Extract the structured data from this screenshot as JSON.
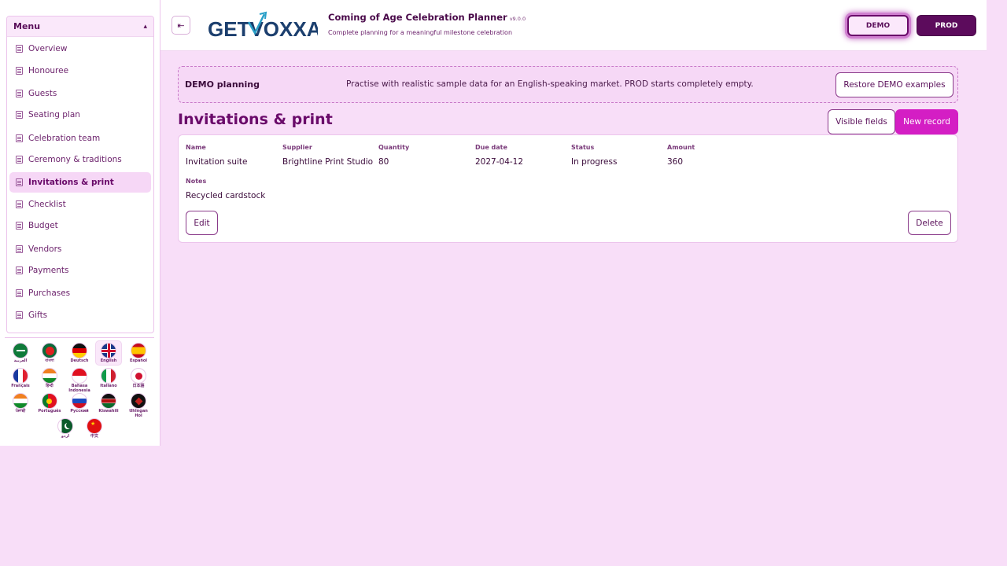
{
  "sidebar": {
    "menu_title": "Menu",
    "menu_toggle": "▴",
    "items": [
      {
        "label": "Overview"
      },
      {
        "label": "Honouree"
      },
      {
        "label": "Guests"
      },
      {
        "label": "Seating plan"
      },
      {
        "label": "Celebration team"
      },
      {
        "label": "Ceremony & traditions"
      },
      {
        "label": "Invitations & print",
        "active": true
      },
      {
        "label": "Checklist"
      },
      {
        "label": "Budget"
      },
      {
        "label": "Vendors"
      },
      {
        "label": "Payments"
      },
      {
        "label": "Purchases"
      },
      {
        "label": "Gifts"
      }
    ],
    "languages": [
      {
        "name": "العربية",
        "flag": "sa"
      },
      {
        "name": "বাংলা",
        "flag": "bd"
      },
      {
        "name": "Deutsch",
        "flag": "de"
      },
      {
        "name": "English",
        "flag": "gb",
        "active": true
      },
      {
        "name": "Español",
        "flag": "es"
      },
      {
        "name": "Français",
        "flag": "fr"
      },
      {
        "name": "हिन्दी",
        "flag": "in"
      },
      {
        "name": "Bahasa Indonesia",
        "flag": "id"
      },
      {
        "name": "Italiano",
        "flag": "it"
      },
      {
        "name": "日本語",
        "flag": "jp"
      },
      {
        "name": "ਪੰਜਾਬੀ",
        "flag": "in"
      },
      {
        "name": "Português",
        "flag": "pt"
      },
      {
        "name": "Русский",
        "flag": "ru"
      },
      {
        "name": "Kiswahili",
        "flag": "ke"
      },
      {
        "name": "tlhIngan Hol",
        "flag": "kl"
      },
      {
        "name": "اردو",
        "flag": "pk"
      },
      {
        "name": "中文",
        "flag": "cn"
      }
    ]
  },
  "header": {
    "logo_text": "GETVOXXA",
    "app_title": "Coming of Age Celebration Planner",
    "version": "v9.0.0",
    "subtitle": "Complete planning for a meaningful milestone celebration",
    "demo_label": "DEMO",
    "prod_label": "PROD"
  },
  "banner": {
    "title": "DEMO planning",
    "description": "Practise with realistic sample data for an English-speaking market. PROD starts completely empty.",
    "restore_label": "Restore DEMO examples"
  },
  "page": {
    "title": "Invitations & print",
    "visible_fields_label": "Visible fields",
    "new_record_label": "New record"
  },
  "record": {
    "labels": {
      "name": "Name",
      "supplier": "Supplier",
      "quantity": "Quantity",
      "due_date": "Due date",
      "status": "Status",
      "amount": "Amount",
      "notes": "Notes"
    },
    "values": {
      "name": "Invitation suite",
      "supplier": "Brightline Print Studio",
      "quantity": "80",
      "due_date": "2027-04-12",
      "status": "In progress",
      "amount": "360",
      "notes": "Recycled cardstock"
    },
    "edit_label": "Edit",
    "delete_label": "Delete"
  },
  "colors": {
    "background": "#f8def8",
    "accent": "#d41ec4",
    "dark_purple": "#5c0b5c"
  }
}
